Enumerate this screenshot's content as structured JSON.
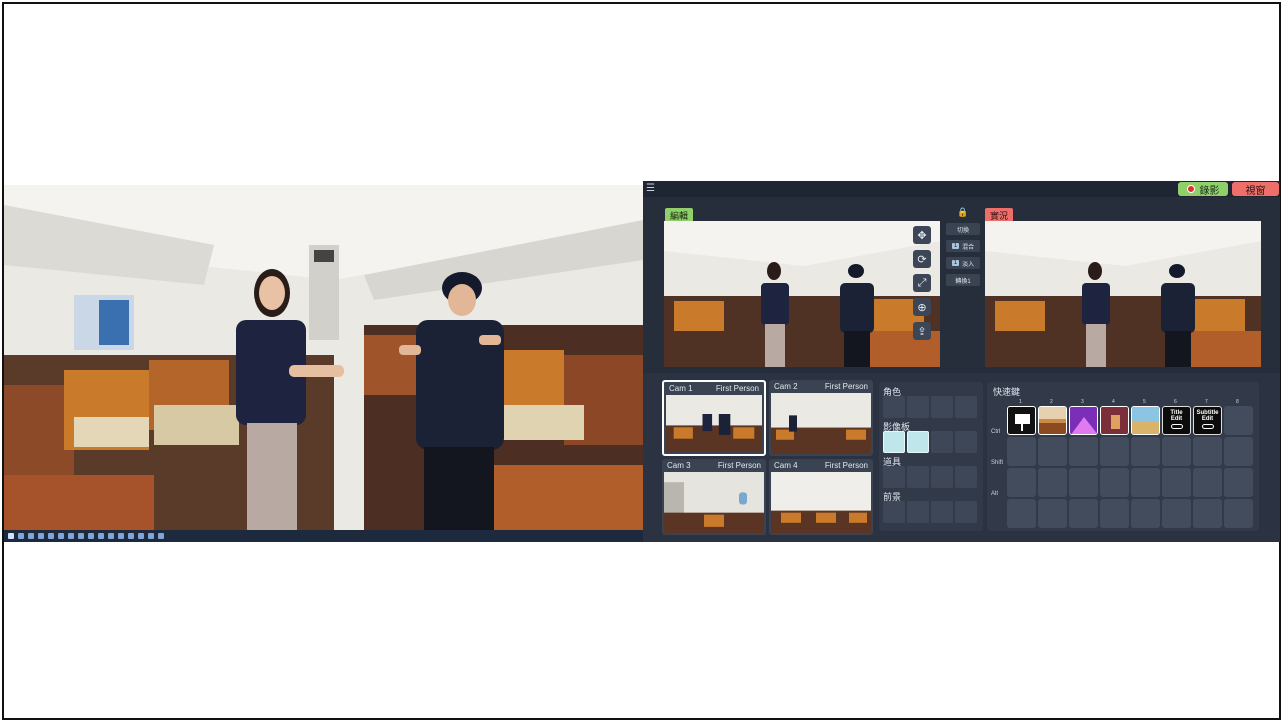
{
  "app": {
    "record_label": "錄影",
    "view_label": "視窗",
    "edit_label": "編輯",
    "live_label": "實況",
    "mid_buttons": [
      {
        "label": "切換",
        "num": ""
      },
      {
        "label": "混合",
        "num": "1"
      },
      {
        "label": "淡入",
        "num": "1"
      },
      {
        "label": "轉換1",
        "num": ""
      }
    ]
  },
  "cameras": [
    {
      "name": "Cam 1",
      "mode": "First Person",
      "active": true
    },
    {
      "name": "Cam 2",
      "mode": "First Person",
      "active": false
    },
    {
      "name": "Cam 3",
      "mode": "First Person",
      "active": false
    },
    {
      "name": "Cam 4",
      "mode": "First Person",
      "active": false
    }
  ],
  "assets": {
    "characters": "角色",
    "video_board": "影像板",
    "props": "道具",
    "foreground": "前景"
  },
  "hotkeys": {
    "title": "快速鍵",
    "columns": [
      "1",
      "2",
      "3",
      "4",
      "5",
      "6",
      "7",
      "8"
    ],
    "rows": [
      "Ctrl",
      "Shift",
      "Alt"
    ],
    "title_edit": [
      "Title",
      "Edit"
    ],
    "subtitle_edit": [
      "Subtitle",
      "Edit"
    ]
  },
  "colors": {
    "record": "#8fd06a",
    "view": "#ee6f6a",
    "app_bg": "#262d3b"
  }
}
